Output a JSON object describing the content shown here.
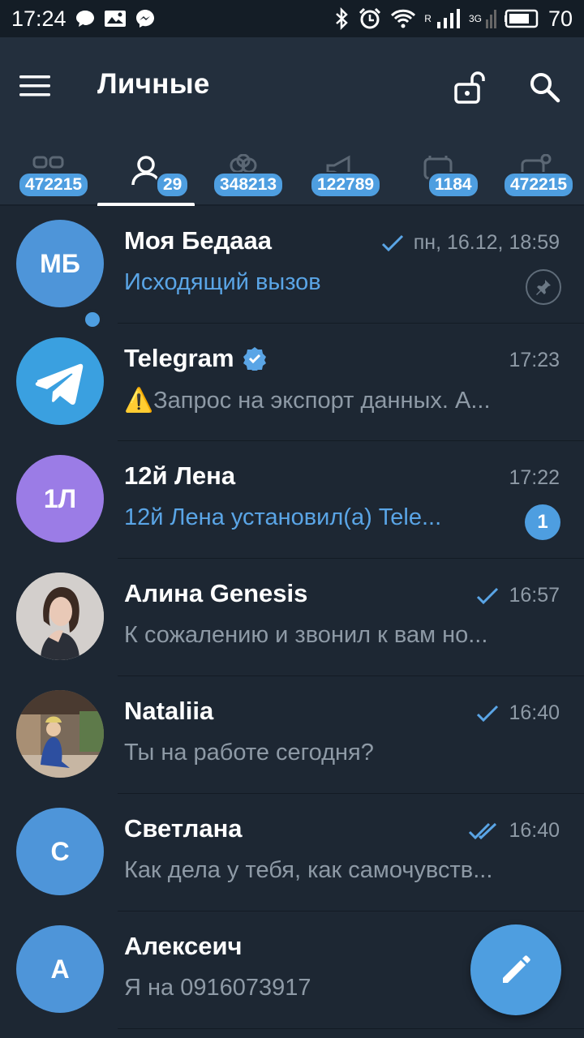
{
  "status_bar": {
    "time": "17:24",
    "signal_letter": "R",
    "network_type": "3G",
    "battery": "70",
    "icons": [
      "chat-bubble-icon",
      "gallery-icon",
      "messenger-icon",
      "bluetooth-icon",
      "alarm-icon",
      "wifi-icon",
      "signal-icon",
      "battery-icon"
    ]
  },
  "app_bar": {
    "title": "Личные",
    "icons": [
      "menu-icon",
      "unlock-icon",
      "search-icon"
    ]
  },
  "tabs": [
    {
      "icon": "all-chats-icon",
      "badge": "472215",
      "selected": false
    },
    {
      "icon": "personal-icon",
      "badge": "29",
      "selected": true
    },
    {
      "icon": "groups-icon",
      "badge": "348213",
      "selected": false
    },
    {
      "icon": "channels-icon",
      "badge": "122789",
      "selected": false
    },
    {
      "icon": "bots-icon",
      "badge": "1184",
      "selected": false
    },
    {
      "icon": "unread-icon",
      "badge": "472215",
      "selected": false
    }
  ],
  "chats": [
    {
      "name": "Моя Бедааа",
      "initials": "МБ",
      "avatar_color": "#4e95d9",
      "time": "пн, 16.12, 18:59",
      "check": "single",
      "preview": "Исходящий вызов",
      "preview_style": "accent",
      "pinned": true
    },
    {
      "name": "Telegram",
      "avatar_color": "#3aa0e0",
      "verified": true,
      "time": "17:23",
      "warning_emoji": "⚠️",
      "preview": "Запрос на экспорт данных. А...",
      "preview_style": "normal"
    },
    {
      "name": "12й Лена",
      "initials": "1Л",
      "avatar_color": "#9b7ce6",
      "online": true,
      "time": "17:22",
      "preview": "12й Лена установил(а) Tele...",
      "preview_style": "accent",
      "unread": "1"
    },
    {
      "name": "Алина Genesis",
      "avatar": "photo",
      "time": "16:57",
      "check": "single",
      "preview": "К сожалению и звонил к вам но...",
      "preview_style": "normal"
    },
    {
      "name": "Nataliia",
      "avatar": "photo",
      "time": "16:40",
      "check": "single",
      "preview": "Ты на работе сегодня?",
      "preview_style": "normal"
    },
    {
      "name": "Светлана",
      "initials": "С",
      "avatar_color": "#4e95d9",
      "time": "16:40",
      "check": "double",
      "preview": "Как дела у тебя, как самочувств...",
      "preview_style": "normal"
    },
    {
      "name": "Алексеич",
      "initials": "А",
      "avatar_color": "#4e95d9",
      "time": "",
      "preview": "Я на 0916073917",
      "preview_style": "normal"
    }
  ],
  "fab": {
    "icon": "pencil-icon"
  },
  "colors": {
    "accent": "#4e9ee0",
    "background": "#1d2733",
    "app_bar": "#232f3d"
  }
}
